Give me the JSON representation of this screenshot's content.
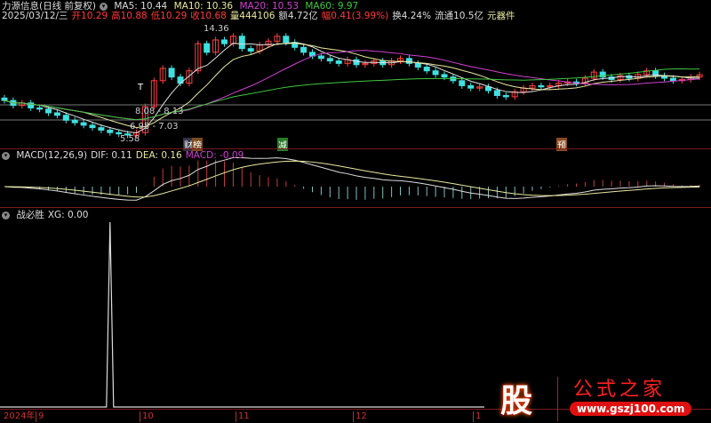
{
  "header": {
    "name": "力源信息(日线 前复权)",
    "ma5": "MA5: 10.44",
    "ma10": "MA10: 10.36",
    "ma20": "MA20: 10.53",
    "ma60": "MA60: 9.97",
    "date": "2025/03/12/三",
    "open": "开10.29",
    "high": "高10.88",
    "low": "低10.29",
    "close": "收10.68",
    "volume": "量444106",
    "amount": "额4.72亿",
    "change": "幅0.41(3.99%)",
    "turnover": "换4.24%",
    "float": "流通10.5亿",
    "sector": "元器件"
  },
  "annotations": {
    "peak": "14.36",
    "low": "5.58",
    "range1": "8.08 - 8.13",
    "range2": "6.95 - 7.03",
    "t_mark": "T"
  },
  "tags": [
    "财",
    "榜",
    "减",
    "预"
  ],
  "macd": {
    "title": "MACD(12,26,9)",
    "dif": "DIF: 0.11",
    "dea": "DEA: 0.16",
    "macd": "MACD: -0.09"
  },
  "xg": {
    "title": "战必胜",
    "value": "XG: 0.00"
  },
  "axis": [
    "2024年",
    "9",
    "10",
    "11",
    "12",
    "1"
  ],
  "logo": {
    "char": "股",
    "name": "公式之家",
    "url": "www.gszj100.com"
  },
  "colors": {
    "up": "#ff4040",
    "down": "#40e0e0",
    "ma5": "#e0e0e0",
    "ma10": "#e8e8a0",
    "ma20": "#d040d0",
    "ma60": "#3ec83e"
  },
  "chart_data": {
    "type": "candlestick",
    "closes": [
      8.6,
      8.2,
      8.4,
      8.0,
      7.9,
      7.6,
      7.4,
      7.0,
      6.8,
      6.6,
      6.4,
      6.2,
      6.0,
      5.9,
      5.8,
      6.0,
      8.1,
      10.2,
      11.2,
      10.5,
      10.0,
      11.0,
      13.2,
      12.5,
      13.5,
      13.2,
      13.8,
      12.8,
      12.6,
      13.1,
      13.4,
      13.8,
      13.3,
      12.9,
      12.5,
      12.2,
      12.0,
      11.8,
      11.6,
      11.9,
      11.5,
      11.6,
      11.8,
      11.5,
      11.8,
      12.0,
      11.6,
      11.3,
      11.0,
      10.7,
      10.5,
      10.2,
      9.8,
      9.6,
      9.7,
      9.4,
      9.0,
      8.9,
      9.3,
      9.6,
      9.8,
      9.7,
      9.8,
      10.0,
      10.1,
      10.0,
      10.4,
      10.9,
      10.5,
      10.3,
      10.6,
      10.4,
      10.7,
      11.0,
      10.6,
      10.4,
      10.2,
      10.3,
      10.5,
      10.68
    ],
    "xg_spike_index": 12,
    "xg_range": [
      0,
      1
    ]
  }
}
